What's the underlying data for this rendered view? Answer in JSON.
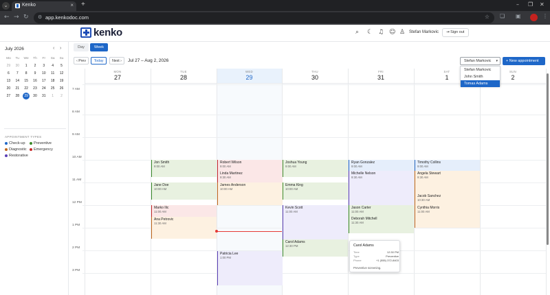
{
  "browser": {
    "tab_title": "Kenko",
    "url": "app.kenkodoc.com"
  },
  "app": {
    "logo_text": "kenko",
    "user_name": "Stefan Markovic",
    "signout_label": "Sign out"
  },
  "mini_calendar": {
    "title": "July 2026",
    "dow": [
      "Mo",
      "Tu",
      "We",
      "Th",
      "Fr",
      "Sa",
      "Su"
    ],
    "weeks": [
      [
        "29",
        "30",
        "1",
        "2",
        "3",
        "4",
        "5"
      ],
      [
        "6",
        "7",
        "8",
        "9",
        "10",
        "11",
        "12"
      ],
      [
        "13",
        "14",
        "15",
        "16",
        "17",
        "18",
        "19"
      ],
      [
        "20",
        "21",
        "22",
        "23",
        "24",
        "25",
        "26"
      ],
      [
        "27",
        "28",
        "29",
        "30",
        "31",
        "1",
        "2"
      ]
    ],
    "selected": "29"
  },
  "appointment_types": {
    "title": "APPOINTMENT TYPES",
    "items": [
      {
        "label": "Check-up",
        "color": "#1e67c8"
      },
      {
        "label": "Preventive",
        "color": "#3a8a2a"
      },
      {
        "label": "Diagnostic",
        "color": "#c0661a"
      },
      {
        "label": "Emergency",
        "color": "#c62828"
      },
      {
        "label": "Restorative",
        "color": "#5b3fb5"
      }
    ]
  },
  "toolbar": {
    "day_label": "Day",
    "week_label": "Week",
    "prev_label": "‹ Prev",
    "today_label": "Today",
    "next_label": "Next ›",
    "range_label": "Jul 27 – Aug 2, 2026",
    "doctor_selected": "Stefan Markovic",
    "new_appointment_label": "+ New appointment"
  },
  "doctor_options": [
    "Stefan Markovic",
    "John Smith",
    "Tomas Adams"
  ],
  "days": [
    {
      "dow": "MON",
      "num": "27"
    },
    {
      "dow": "TUE",
      "num": "28"
    },
    {
      "dow": "WED",
      "num": "29"
    },
    {
      "dow": "THU",
      "num": "30"
    },
    {
      "dow": "FRI",
      "num": "31"
    },
    {
      "dow": "SAT",
      "num": "1"
    },
    {
      "dow": "SUN",
      "num": "2"
    }
  ],
  "hours": [
    "7 AM",
    "8 AM",
    "9 AM",
    "10 AM",
    "11 AM",
    "12 PM",
    "1 PM",
    "2 PM",
    "3 PM"
  ],
  "appointments": {
    "tue_1": {
      "name": "Jon Smith",
      "time": "9:00 AM"
    },
    "tue_2": {
      "name": "Jane Doe",
      "time": "10:00 AM"
    },
    "tue_3": {
      "name": "Marko Ilic",
      "time": "11:00 AM"
    },
    "tue_4": {
      "name": "Ana Petrovic",
      "time": "11:30 AM"
    },
    "wed_1": {
      "name": "Robert Wilson",
      "time": "9:00 AM"
    },
    "wed_2": {
      "name": "Linda Martinez",
      "time": "9:30 AM"
    },
    "wed_3": {
      "name": "James Anderson",
      "time": "10:00 AM"
    },
    "wed_4": {
      "name": "Patricia Lee",
      "time": "1:00 PM"
    },
    "thu_1": {
      "name": "Joshua Young",
      "time": "9:00 AM"
    },
    "thu_2": {
      "name": "Emma King",
      "time": "10:00 AM"
    },
    "thu_3": {
      "name": "Kevin Scott",
      "time": "11:00 AM"
    },
    "thu_4": {
      "name": "Carol Adams",
      "time": "12:30 PM"
    },
    "fri_1": {
      "name": "Ryan Gonzalez",
      "time": "9:00 AM"
    },
    "fri_2": {
      "name": "Michelle Nelson",
      "time": "9:30 AM"
    },
    "fri_3": {
      "name": "Jason Carter",
      "time": "11:00 AM"
    },
    "fri_4": {
      "name": "Deborah Mitchell",
      "time": "11:30 AM"
    },
    "sat_1": {
      "name": "Timothy Collins",
      "time": "9:00 AM"
    },
    "sat_2": {
      "name": "Angela Stewart",
      "time": "9:30 AM"
    },
    "sat_3": {
      "name": "Jacob Sanchez",
      "time": "10:30 AM"
    },
    "sat_4": {
      "name": "Cynthia Morris",
      "time": "11:00 AM"
    }
  },
  "tooltip": {
    "name": "Carol Adams",
    "time_label": "Time",
    "time_value": "12:30 PM",
    "type_label": "Type",
    "type_value": "Preventive",
    "phone_label": "Phone",
    "phone_value": "+1 (555) 372-8403",
    "note": "Preventive screening."
  }
}
